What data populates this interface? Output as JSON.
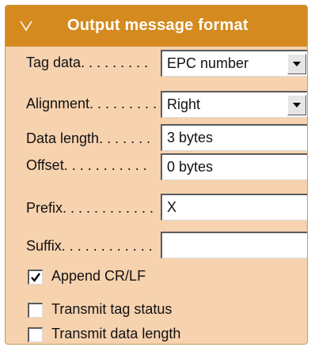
{
  "panel": {
    "title": "Output message format",
    "icon": "chevron-down-icon"
  },
  "fields": {
    "tag_data": {
      "label": "Tag data",
      "dots": ". . . . . . . . .",
      "value": "EPC number"
    },
    "alignment": {
      "label": "Alignment",
      "dots": ". . . . . . . . .",
      "value": "Right"
    },
    "data_length": {
      "label": "Data length",
      "dots": ". . . . . . .",
      "value": "3 bytes"
    },
    "offset": {
      "label": "Offset",
      "dots": ". . . . . . . . . . .",
      "value": "0 bytes"
    },
    "prefix": {
      "label": "Prefix",
      "dots": ". . . . . . . . . . . .",
      "value": "X"
    },
    "suffix": {
      "label": "Suffix",
      "dots": ". . . . . . . . . . . .",
      "value": ""
    }
  },
  "options": {
    "append_crlf": {
      "label": "Append CR/LF",
      "checked": true
    },
    "transmit_tag_status": {
      "label": "Transmit tag status",
      "checked": false
    },
    "transmit_data_length": {
      "label": "Transmit data length",
      "checked": false
    }
  },
  "colors": {
    "header": "#d48a1e",
    "panel_bg": "#f7d2af"
  }
}
